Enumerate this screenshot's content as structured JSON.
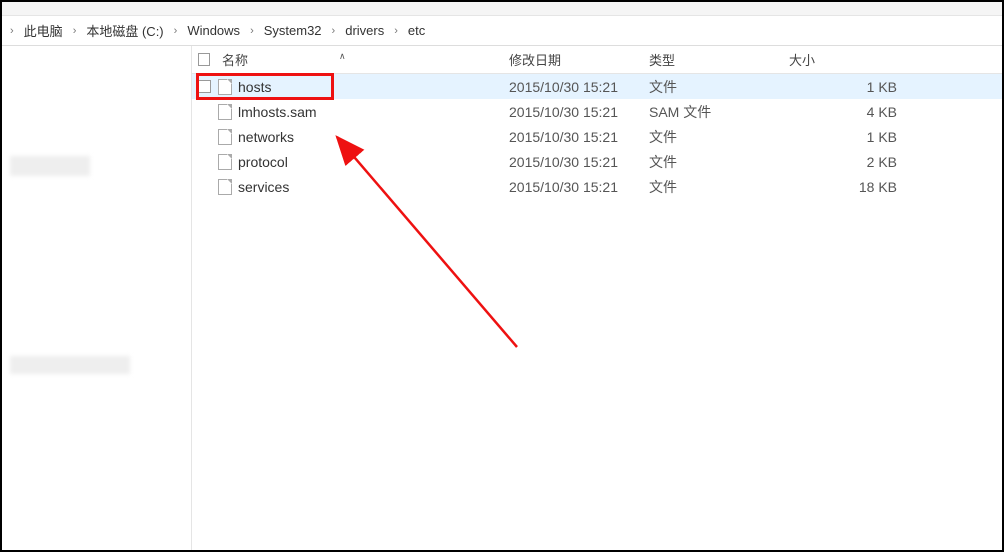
{
  "breadcrumb": {
    "items": [
      {
        "label": "此电脑"
      },
      {
        "label": "本地磁盘 (C:)"
      },
      {
        "label": "Windows"
      },
      {
        "label": "System32"
      },
      {
        "label": "drivers"
      },
      {
        "label": "etc"
      }
    ]
  },
  "columns": {
    "name": "名称",
    "date": "修改日期",
    "type": "类型",
    "size": "大小"
  },
  "files": [
    {
      "name": "hosts",
      "date": "2015/10/30 15:21",
      "type": "文件",
      "size": "1 KB",
      "selected": true
    },
    {
      "name": "lmhosts.sam",
      "date": "2015/10/30 15:21",
      "type": "SAM 文件",
      "size": "4 KB",
      "selected": false
    },
    {
      "name": "networks",
      "date": "2015/10/30 15:21",
      "type": "文件",
      "size": "1 KB",
      "selected": false
    },
    {
      "name": "protocol",
      "date": "2015/10/30 15:21",
      "type": "文件",
      "size": "2 KB",
      "selected": false
    },
    {
      "name": "services",
      "date": "2015/10/30 15:21",
      "type": "文件",
      "size": "18 KB",
      "selected": false
    }
  ],
  "annotation": {
    "highlight_index": 0
  }
}
